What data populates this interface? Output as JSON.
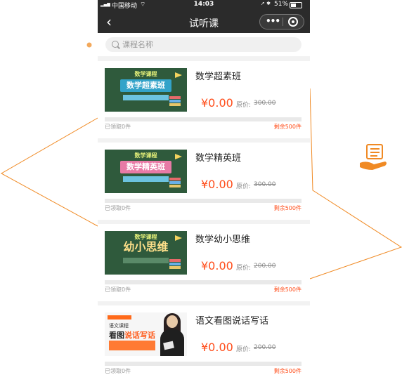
{
  "status_bar": {
    "signal_glyph": "▂▄▆",
    "carrier": "中国移动",
    "wifi_glyph": "⌔",
    "time": "14:03",
    "right_glyphs": "➚ ✱",
    "battery_percent": "51%",
    "battery_level": 0.51
  },
  "nav": {
    "back_glyph": "‹",
    "title": "试听课",
    "more_glyph": "•••"
  },
  "search": {
    "placeholder": "课程名称"
  },
  "colors": {
    "accent": "#ff4d1a",
    "progress": "#ff7a33",
    "header_bg": "#2b2b2b",
    "deco_line": "#f08a24"
  },
  "courses": [
    {
      "name": "数学超素班",
      "price": "¥0.00",
      "orig_label": "原价:",
      "orig_price": "300.00",
      "claimed": "已领取0件",
      "remaining": "剩余500件",
      "claimed_fraction": 0,
      "thumb": {
        "top": "数学课程",
        "main": "数学超素班"
      }
    },
    {
      "name": "数学精英班",
      "price": "¥0.00",
      "orig_label": "原价:",
      "orig_price": "300.00",
      "claimed": "已领取0件",
      "remaining": "剩余500件",
      "claimed_fraction": 0,
      "thumb": {
        "top": "数学课程",
        "main": "数学精英班"
      }
    },
    {
      "name": "数学幼小思维",
      "price": "¥0.00",
      "orig_label": "原价:",
      "orig_price": "200.00",
      "claimed": "已领取0件",
      "remaining": "剩余500件",
      "claimed_fraction": 0,
      "thumb": {
        "top": "数学课程",
        "main": "幼小思维"
      }
    },
    {
      "name": "语文看图说话写话",
      "price": "¥0.00",
      "orig_label": "原价:",
      "orig_price": "200.00",
      "claimed": "已领取0件",
      "remaining": "剩余500件",
      "claimed_fraction": 0,
      "thumb": {
        "title": "语文课程",
        "main_a": "看图",
        "main_b": "说话写话"
      }
    }
  ]
}
